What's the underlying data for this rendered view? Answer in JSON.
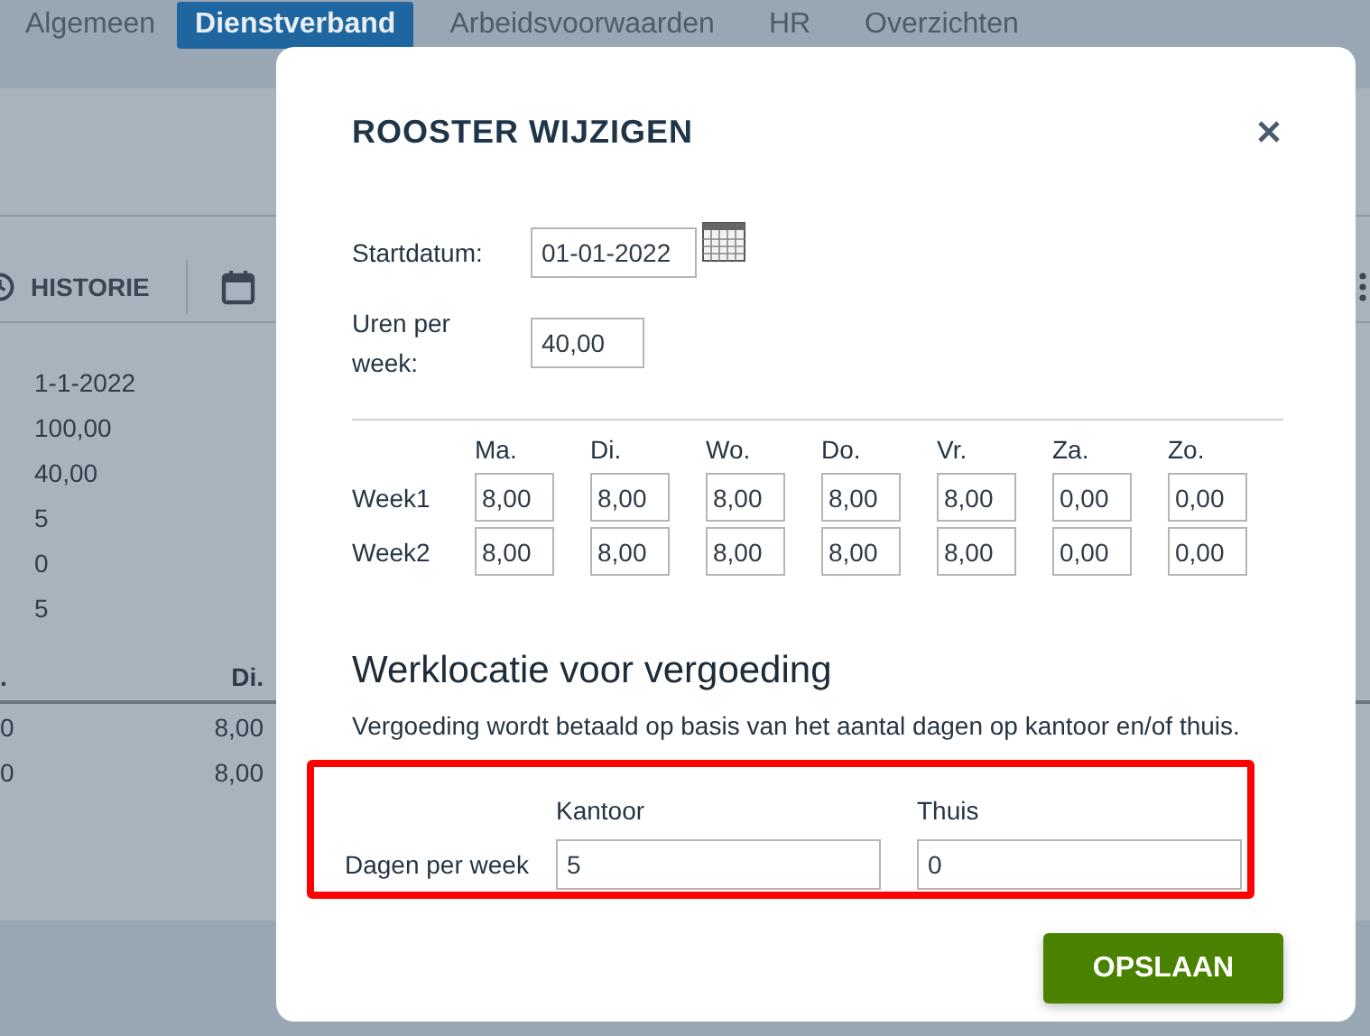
{
  "tabs": [
    {
      "label": "Algemeen",
      "selected": false
    },
    {
      "label": "Dienstverband",
      "selected": true
    },
    {
      "label": "Arbeidsvoorwaarden",
      "selected": false
    },
    {
      "label": "HR",
      "selected": false
    },
    {
      "label": "Overzichten",
      "selected": false
    }
  ],
  "toolbar": [
    {
      "kind": "clock",
      "label": "HISTORIE"
    },
    {
      "kind": "calendar"
    }
  ],
  "summary_values": [
    "1-1-2022",
    "100,00",
    "40,00",
    "5",
    "0",
    "5"
  ],
  "table": {
    "columns": [
      ".",
      "Di."
    ],
    "rows": [
      [
        "0",
        "8,00"
      ],
      [
        "0",
        "8,00"
      ]
    ]
  },
  "dialog": {
    "title": "ROOSTER WIJZIGEN",
    "start_date": {
      "label": "Startdatum:",
      "value": "01-01-2022"
    },
    "hours_per_week": {
      "label": "Uren per week:",
      "value": "40,00"
    },
    "schedule": {
      "days": [
        "Ma.",
        "Di.",
        "Wo.",
        "Do.",
        "Vr.",
        "Za.",
        "Zo."
      ],
      "weeks": [
        {
          "label": "Week1",
          "hours": [
            "8,00",
            "8,00",
            "8,00",
            "8,00",
            "8,00",
            "0,00",
            "0,00"
          ]
        },
        {
          "label": "Week2",
          "hours": [
            "8,00",
            "8,00",
            "8,00",
            "8,00",
            "8,00",
            "0,00",
            "0,00"
          ]
        }
      ]
    },
    "work_location": {
      "heading": "Werklocatie voor vergoeding",
      "description": "Vergoeding wordt betaald op basis van het aantal dagen op kantoor en/of thuis.",
      "highlighted": true,
      "row_label": "Dagen per week",
      "columns": [
        {
          "label": "Kantoor",
          "value": "5"
        },
        {
          "label": "Thuis",
          "value": "0"
        }
      ]
    },
    "save_button": "OPSLAAN"
  }
}
